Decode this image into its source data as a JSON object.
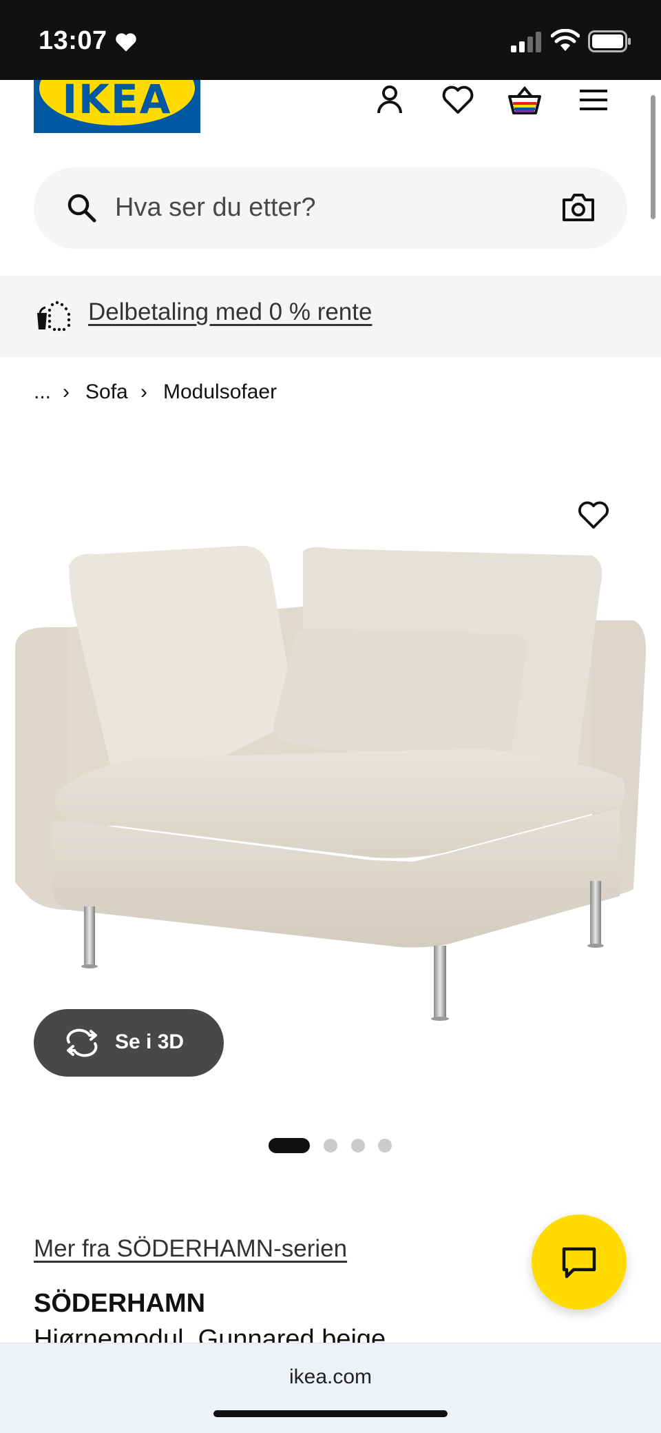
{
  "status_bar": {
    "time": "13:07"
  },
  "header": {
    "logo_text": "IKEA"
  },
  "search": {
    "placeholder": "Hva ser du etter?"
  },
  "promo": {
    "link_text": "Delbetaling med 0 % rente"
  },
  "breadcrumb": {
    "items": [
      "...",
      "Sofa",
      "Modulsofaer"
    ],
    "separator": "›"
  },
  "media": {
    "view_3d_label": "Se i 3D",
    "gallery_count": 4,
    "active_index": 0
  },
  "product": {
    "series_link": "Mer fra SÖDERHAMN-serien",
    "name": "SÖDERHAMN",
    "description": "Hjørnemodul, Gunnared beige"
  },
  "browser": {
    "url": "ikea.com"
  },
  "colors": {
    "ikea_blue": "#0058a3",
    "ikea_yellow": "#ffdb00",
    "button_dark": "#484848"
  },
  "icons": [
    "heart-icon",
    "person-icon",
    "cart-icon",
    "menu-icon",
    "search-icon",
    "camera-icon",
    "installment-icon",
    "rotate-3d-icon",
    "chat-icon",
    "wifi-icon",
    "battery-icon",
    "signal-icon"
  ]
}
